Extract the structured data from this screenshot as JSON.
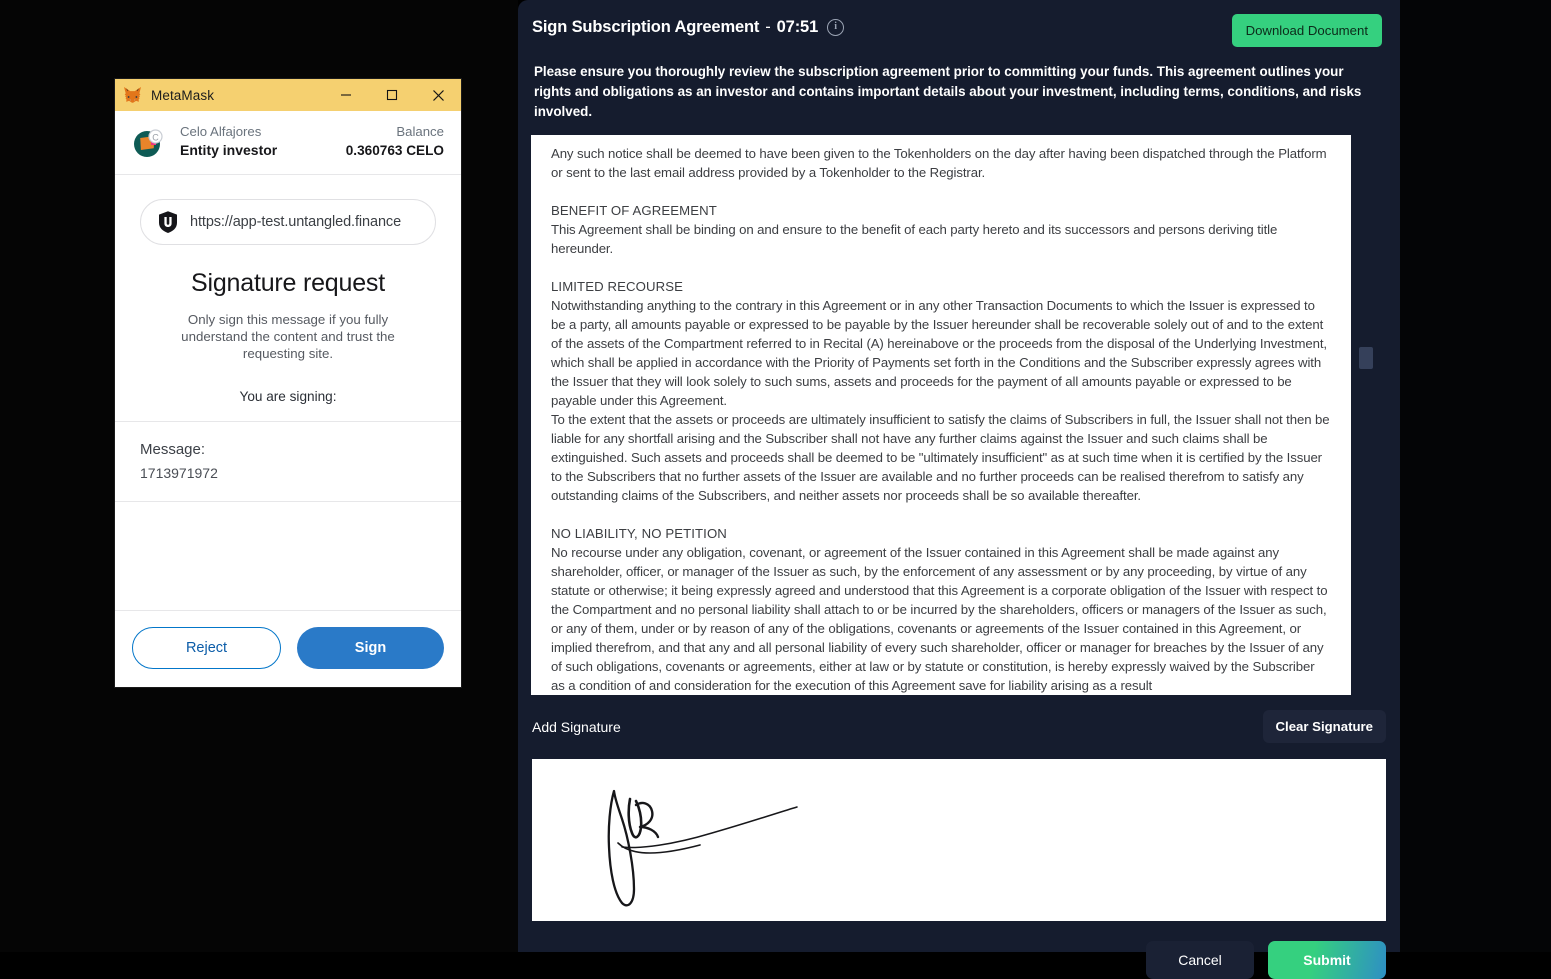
{
  "metamask": {
    "window_title": "MetaMask",
    "icons": {
      "fox": "fox-icon",
      "minimize": "minimize-icon",
      "maximize": "maximize-icon",
      "close": "close-icon",
      "network": "celo-network-icon",
      "site": "untangled-logo-icon"
    },
    "network_name": "Celo Alfajores",
    "account_name": "Entity investor",
    "balance_label": "Balance",
    "balance_value": "0.360763 CELO",
    "site_url": "https://app-test.untangled.finance",
    "signature_title": "Signature request",
    "signature_subtitle": "Only sign this message if you fully understand the content and trust the requesting site.",
    "signing_label": "You are signing:",
    "message_label": "Message:",
    "message_value": "1713971972",
    "reject_label": "Reject",
    "sign_label": "Sign"
  },
  "modal": {
    "title": "Sign Subscription Agreement",
    "dash": "-",
    "time": "07:51",
    "info_icon": "info-icon",
    "download_label": "Download Document",
    "description": "Please ensure you thoroughly review the subscription agreement prior to committing your funds. This agreement outlines your rights and obligations as an investor and contains important details about your investment, including terms, conditions, and risks involved.",
    "signature_section_label": "Add Signature",
    "clear_signature_label": "Clear Signature",
    "cancel_label": "Cancel",
    "submit_label": "Submit",
    "colors": {
      "modal_background": "#151c2e",
      "download_green": "#35d07f",
      "submit_gradient_start": "#35d07f",
      "submit_gradient_end": "#2e8fc4",
      "scrollbar_thumb": "#35405a"
    }
  },
  "document": {
    "paragraphs": [
      {
        "style": "body",
        "text": "Any such notice shall be deemed to have been given to the Tokenholders on the day after having been dispatched through the Platform or sent to the last email address provided by a Tokenholder to the Registrar."
      },
      {
        "style": "heading",
        "text": "BENEFIT OF AGREEMENT"
      },
      {
        "style": "body-tight",
        "text": "This Agreement shall be binding on and ensure to the benefit of each party hereto and its successors and persons deriving title hereunder."
      },
      {
        "style": "heading",
        "text": "LIMITED RECOURSE"
      },
      {
        "style": "body-tight",
        "text": "Notwithstanding anything to the contrary in this Agreement or in any other Transaction Documents to which the Issuer is expressed to be a party, all amounts payable or expressed to be payable by the Issuer hereunder shall be recoverable solely out of and to the extent of the assets of the Compartment referred to in Recital (A) hereinabove or the proceeds from the disposal of the Underlying Investment, which shall be applied in accordance with the Priority of Payments set forth in the Conditions and the Subscriber expressly agrees with the Issuer that they will look solely to such sums, assets and proceeds for the payment of all amounts payable or expressed to be payable under this Agreement."
      },
      {
        "style": "body-tight",
        "text": "To the extent that the assets or proceeds are ultimately insufficient to satisfy the claims of Subscribers in full, the Issuer shall not then be liable for any shortfall arising and the Subscriber shall not have any further claims against the Issuer and such claims shall be extinguished. Such assets and proceeds shall be deemed to be \"ultimately insufficient\" as at such time when it is certified by the Issuer to the Subscribers that no further assets of the Issuer are available and no further proceeds can be realised therefrom to satisfy any outstanding claims of the Subscribers, and neither assets nor proceeds shall be so available thereafter."
      },
      {
        "style": "heading",
        "text": "NO LIABILITY, NO PETITION"
      },
      {
        "style": "body-tight",
        "text": "No recourse under any obligation, covenant, or agreement of the Issuer contained in this Agreement shall be made against any shareholder, officer, or manager of the Issuer as such, by the enforcement of any assessment or by any proceeding, by virtue of any statute or otherwise; it being expressly agreed and understood that this Agreement is a corporate obligation of the Issuer with respect to the Compartment and no personal liability shall attach to or be incurred by the shareholders, officers or managers of the Issuer as such, or any of them, under or by reason of any of the obligations, covenants or agreements of the Issuer contained in this Agreement, or implied therefrom, and that any and all personal liability of every such shareholder, officer or manager for breaches by the Issuer of any of such obligations, covenants or agreements, either at law or by statute or constitution, is hereby expressly waived by the Subscriber as a condition of and consideration for the execution of this Agreement save for liability arising as a result"
      }
    ]
  }
}
